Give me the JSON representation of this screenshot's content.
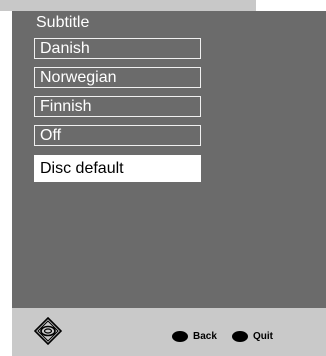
{
  "menu": {
    "title": "Subtitle",
    "options": [
      {
        "label": "Danish"
      },
      {
        "label": "Norwegian"
      },
      {
        "label": "Finnish"
      },
      {
        "label": "Off"
      },
      {
        "label": "Disc default"
      }
    ],
    "selected": "Disc default"
  },
  "footer": {
    "nav_icon": "dpad-icon",
    "back_label": "Back",
    "quit_label": "Quit"
  },
  "colors": {
    "panel": "#6b6b6b",
    "footer": "#c9c9c9",
    "top_strip": "#c8c8c8",
    "selected_bg": "#ffffff",
    "text": "#ffffff"
  }
}
